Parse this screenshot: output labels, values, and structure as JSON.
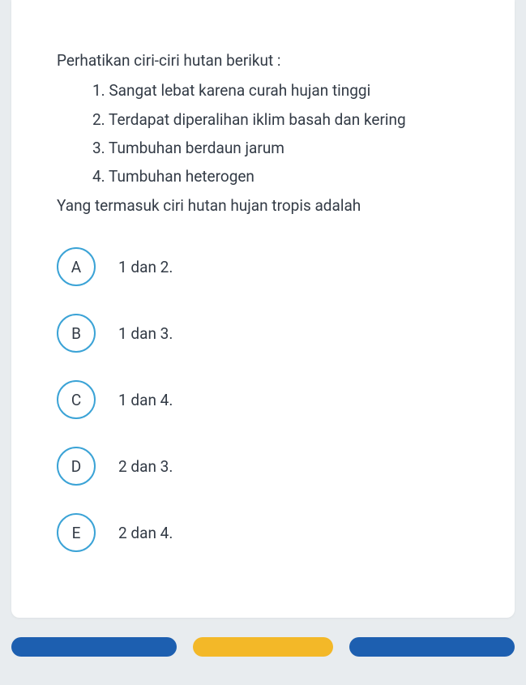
{
  "question": {
    "intro": "Perhatikan ciri-ciri hutan berikut :",
    "items": [
      "1. Sangat lebat karena curah hujan tinggi",
      "2. Terdapat diperalihan iklim basah dan kering",
      "3. Tumbuhan berdaun jarum",
      "4. Tumbuhan heterogen"
    ],
    "closing": "Yang termasuk ciri hutan hujan tropis adalah"
  },
  "options": [
    {
      "letter": "A",
      "text": "1 dan 2."
    },
    {
      "letter": "B",
      "text": "1 dan 3."
    },
    {
      "letter": "C",
      "text": "1 dan 4."
    },
    {
      "letter": "D",
      "text": "2 dan 3."
    },
    {
      "letter": "E",
      "text": "2 dan 4."
    }
  ],
  "nav": {
    "prev": "",
    "mark": "",
    "next": ""
  }
}
